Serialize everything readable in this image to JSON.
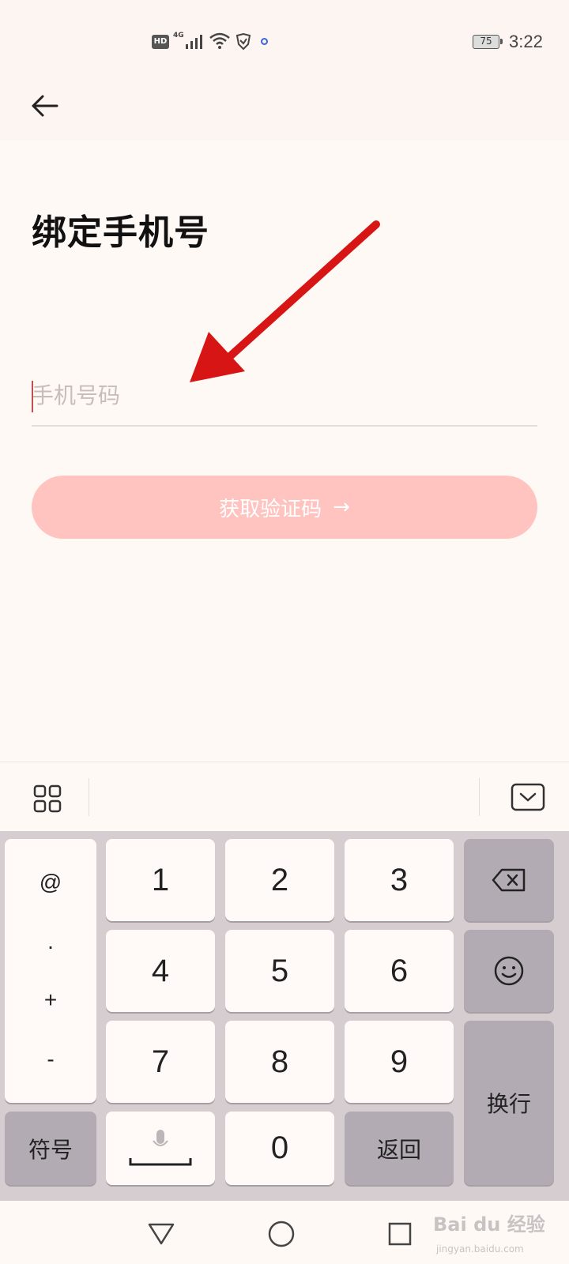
{
  "status_bar": {
    "hd": "HD",
    "network": "4G",
    "battery": "75",
    "time": "3:22"
  },
  "page": {
    "title": "绑定手机号"
  },
  "form": {
    "phone_placeholder": "手机号码",
    "phone_value": "",
    "get_code_label": "获取验证码",
    "get_code_arrow": "→",
    "button_color": "#ffc4c0"
  },
  "keypad": {
    "symbols": [
      "@",
      ".",
      "+",
      "-"
    ],
    "digits": [
      "1",
      "2",
      "3",
      "4",
      "5",
      "6",
      "7",
      "8",
      "9",
      "0"
    ],
    "symbol_key": "符号",
    "return_key": "返回",
    "newline_key": "换行"
  },
  "watermark": {
    "main": "Bai du 经验",
    "sub": "jingyan.baidu.com"
  },
  "icons": {
    "back": "arrow-left-icon",
    "grid": "grid-icon",
    "hide_keyboard": "chevron-down-icon",
    "backspace": "backspace-icon",
    "emoji": "smiley-icon",
    "mic": "microphone-icon",
    "nav_back": "triangle-back-icon",
    "nav_home": "circle-home-icon",
    "nav_recent": "square-recent-icon"
  }
}
